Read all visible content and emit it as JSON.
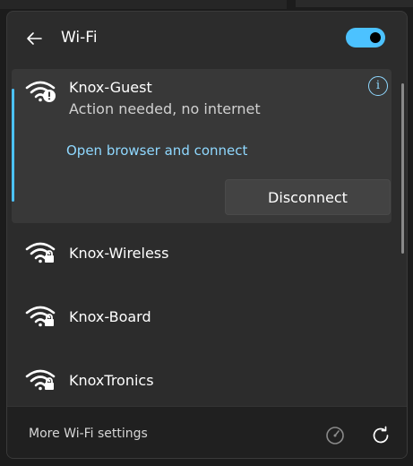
{
  "header": {
    "title": "Wi-Fi",
    "toggle_on": true
  },
  "networks": [
    {
      "name": "Knox-Guest",
      "status": "Action needed, no internet",
      "link": "Open browser and connect",
      "action": "Disconnect",
      "icon": "wifi-warning-icon",
      "connected": true
    },
    {
      "name": "Knox-Wireless",
      "icon": "wifi-secured-icon"
    },
    {
      "name": "Knox-Board",
      "icon": "wifi-secured-icon"
    },
    {
      "name": "KnoxTronics",
      "icon": "wifi-secured-icon"
    }
  ],
  "footer": {
    "settings_label": "More Wi-Fi settings"
  },
  "colors": {
    "accent": "#4cc2ff",
    "link": "#8fd8ff",
    "panel": "#2c2c2c",
    "selected_row": "#383838"
  }
}
